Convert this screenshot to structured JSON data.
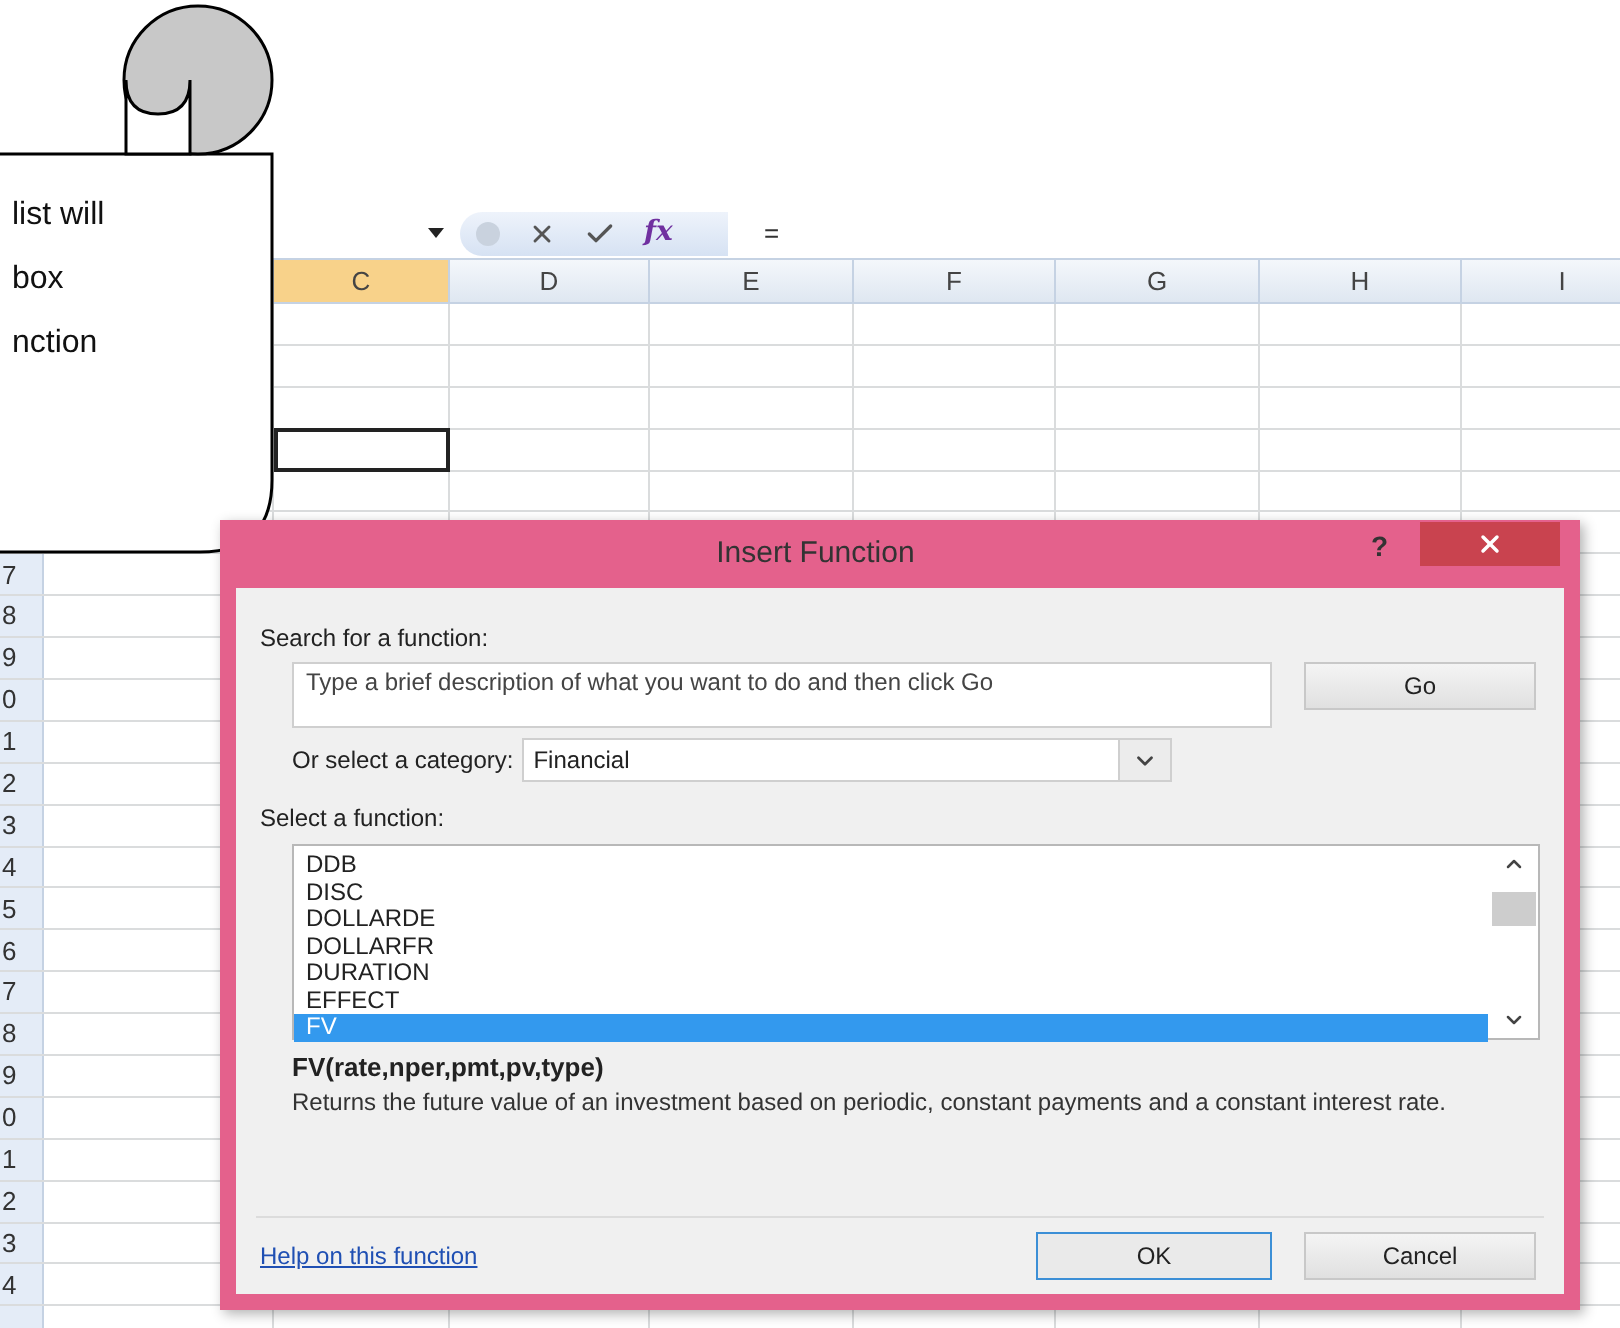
{
  "callout": {
    "lines": [
      "list will",
      "box",
      "nction"
    ]
  },
  "formula_bar": {
    "fx": "fx",
    "formula": "="
  },
  "sheet": {
    "columns": [
      {
        "label": "C",
        "selected": true
      },
      {
        "label": "D",
        "selected": false
      },
      {
        "label": "E",
        "selected": false
      },
      {
        "label": "F",
        "selected": false
      },
      {
        "label": "G",
        "selected": false
      },
      {
        "label": "H",
        "selected": false
      },
      {
        "label": "I",
        "selected": false
      }
    ],
    "row_numbers": [
      "7",
      "8",
      "9",
      "0",
      "1",
      "2",
      "3",
      "4",
      "5",
      "6",
      "7",
      "8",
      "9",
      "0",
      "1",
      "2",
      "3",
      "4"
    ]
  },
  "dialog": {
    "title": "Insert Function",
    "help_glyph": "?",
    "search_label": "Search for a function:",
    "search_value": "Type a brief description of what you want to do and then click Go",
    "go_button": "Go",
    "category_label": "Or select a category:",
    "category": "Financial",
    "list_label": "Select a function:",
    "functions": [
      {
        "name": "DDB",
        "selected": false
      },
      {
        "name": "DISC",
        "selected": false
      },
      {
        "name": "DOLLARDE",
        "selected": false
      },
      {
        "name": "DOLLARFR",
        "selected": false
      },
      {
        "name": "DURATION",
        "selected": false
      },
      {
        "name": "EFFECT",
        "selected": false
      },
      {
        "name": "FV",
        "selected": true
      }
    ],
    "signature": "FV(rate,nper,pmt,pv,type)",
    "description": "Returns the future value of an investment based on periodic, constant payments and a constant interest rate.",
    "help_link": "Help on this function",
    "ok_button": "OK",
    "cancel_button": "Cancel"
  }
}
